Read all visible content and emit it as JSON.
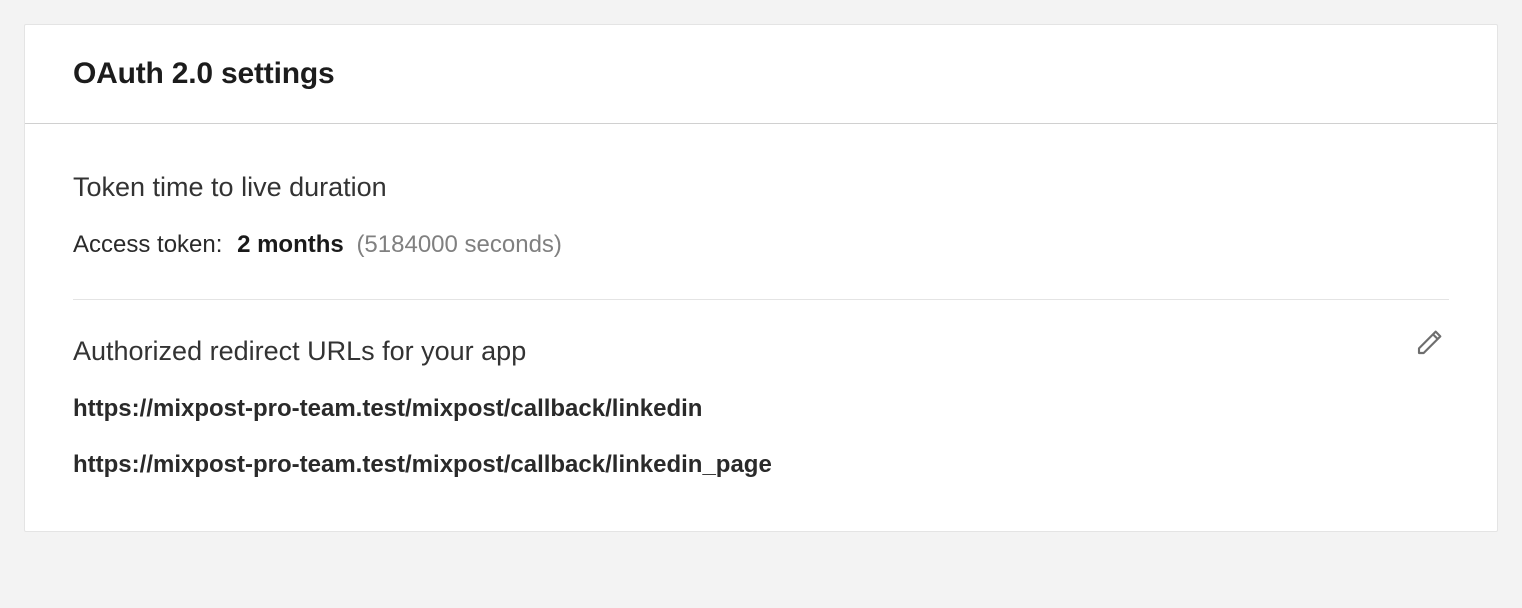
{
  "header": {
    "title": "OAuth 2.0 settings"
  },
  "token_section": {
    "heading": "Token time to live duration",
    "access_label": "Access token:",
    "duration_human": "2 months",
    "duration_seconds": "(5184000 seconds)"
  },
  "redirect_section": {
    "heading": "Authorized redirect URLs for your app",
    "urls": [
      "https://mixpost-pro-team.test/mixpost/callback/linkedin",
      "https://mixpost-pro-team.test/mixpost/callback/linkedin_page"
    ]
  }
}
